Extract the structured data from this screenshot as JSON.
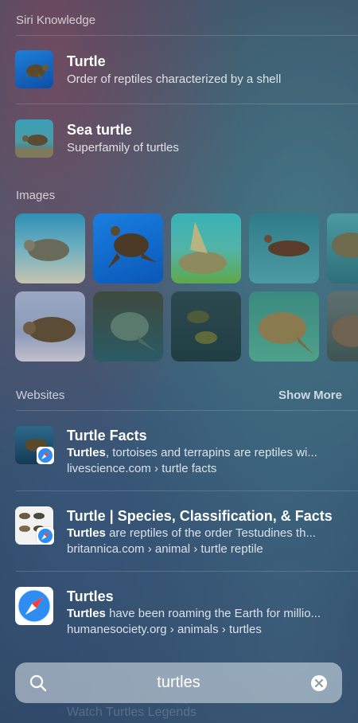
{
  "siri_section": {
    "header": "Siri Knowledge",
    "items": [
      {
        "title": "Turtle",
        "subtitle": "Order of reptiles characterized by a shell"
      },
      {
        "title": "Sea turtle",
        "subtitle": "Superfamily of turtles"
      }
    ]
  },
  "images_section": {
    "header": "Images"
  },
  "websites_section": {
    "header": "Websites",
    "show_more": "Show More",
    "items": [
      {
        "title": "Turtle Facts",
        "highlight": "Turtles",
        "snippet": ", tortoises and terrapins are reptiles wi...",
        "url": "livescience.com › turtle facts"
      },
      {
        "title": "Turtle | Species, Classification, & Facts",
        "highlight": "Turtles",
        "snippet": " are reptiles of the order Testudines th...",
        "url": "britannica.com › animal › turtle reptile"
      },
      {
        "title": "Turtles",
        "highlight": "Turtles",
        "snippet": " have been roaming the Earth for millio...",
        "url": "humanesociety.org › animals › turtles"
      }
    ]
  },
  "search": {
    "value": "turtles"
  },
  "bottom_hint": "Watch Turtles Legends",
  "icons": [
    "search-icon",
    "clear-icon",
    "safari-icon"
  ]
}
